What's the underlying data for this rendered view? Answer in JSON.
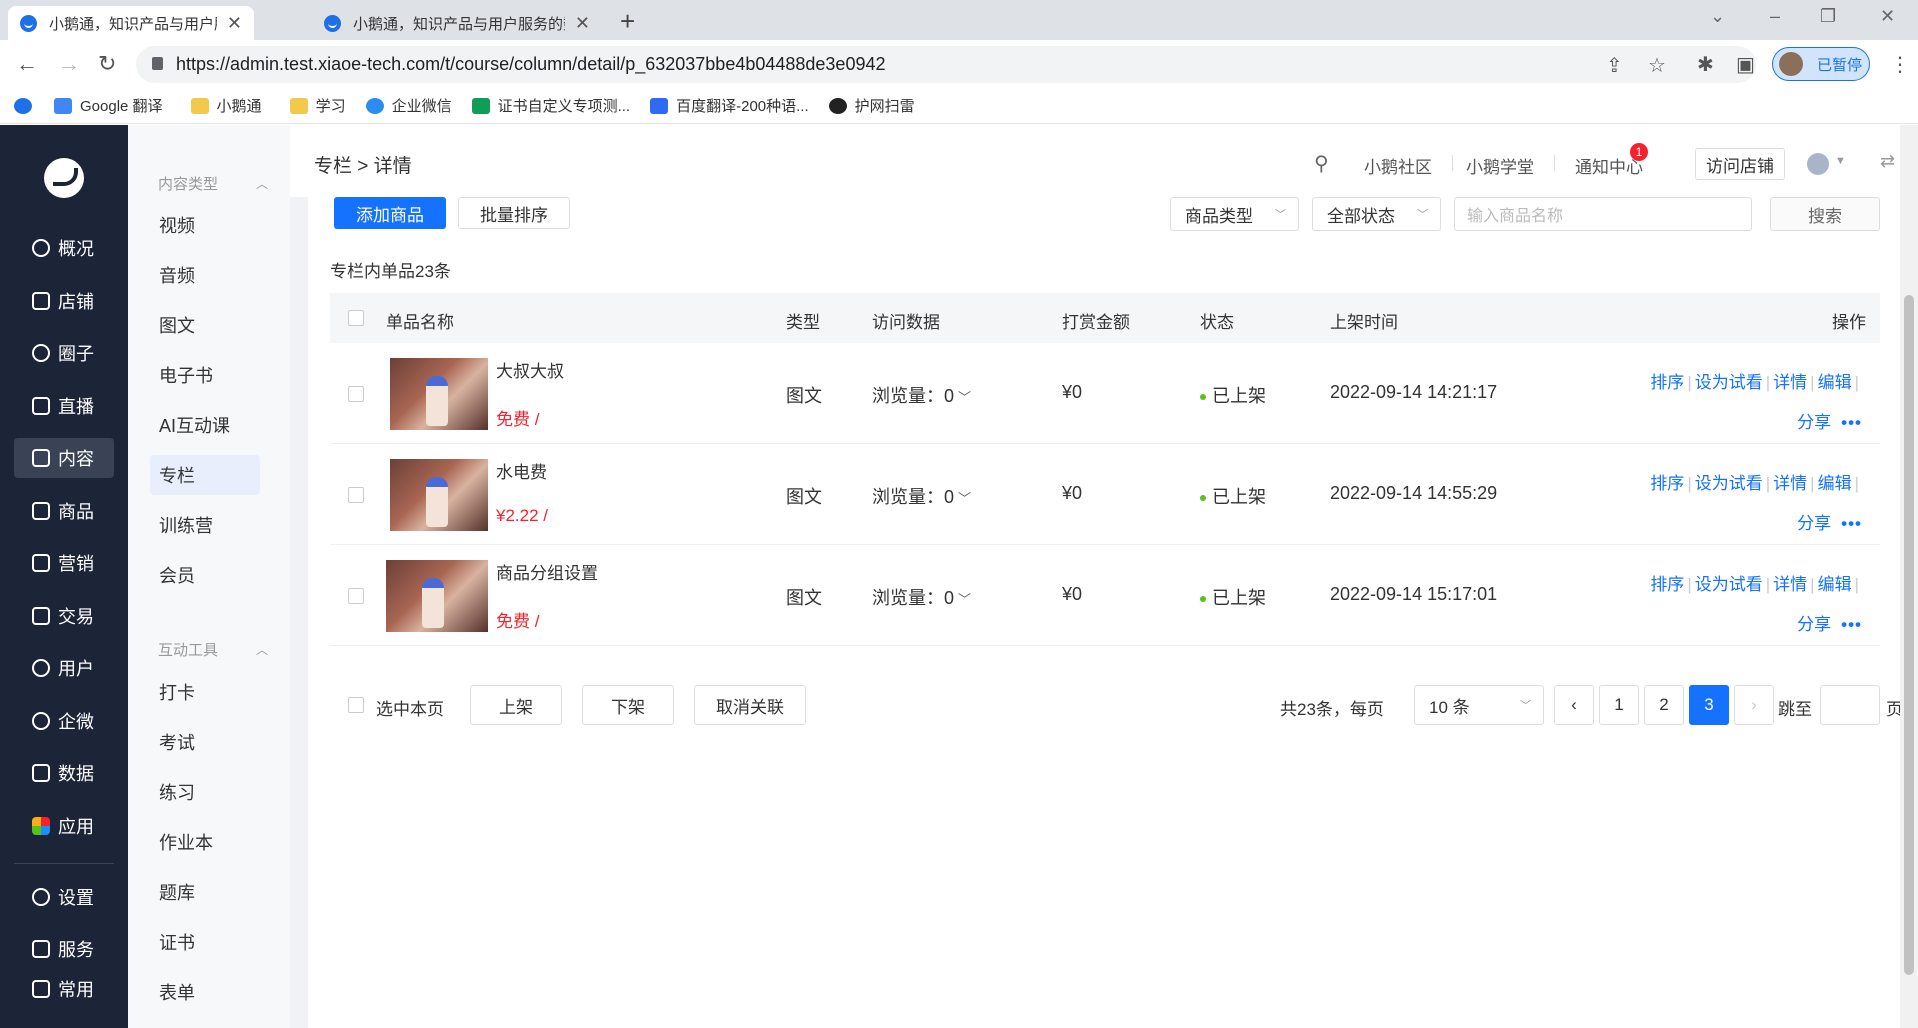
{
  "browser": {
    "tabs": [
      {
        "title": "小鹅通，知识产品与用户服务的数字化工具"
      },
      {
        "title": "小鹅通，知识产品与用户服务的数字化工具"
      }
    ],
    "url": "https://admin.test.xiaoe-tech.com/t/course/column/detail/p_632037bbe4b04488de3e0942",
    "profile_label": "已暂停",
    "bookmarks": [
      "Google 翻译",
      "小鹅通",
      "学习",
      "企业微信",
      "证书自定义专项测...",
      "百度翻译-200种语...",
      "护网扫雷"
    ]
  },
  "sidebar": {
    "items": [
      {
        "label": "概况",
        "icon": "pie-chart-icon"
      },
      {
        "label": "店铺",
        "icon": "store-icon"
      },
      {
        "label": "圈子",
        "icon": "community-icon"
      },
      {
        "label": "直播",
        "icon": "live-icon"
      },
      {
        "label": "内容",
        "icon": "content-icon"
      },
      {
        "label": "商品",
        "icon": "product-icon"
      },
      {
        "label": "营销",
        "icon": "megaphone-icon"
      },
      {
        "label": "交易",
        "icon": "trade-icon"
      },
      {
        "label": "用户",
        "icon": "user-icon"
      },
      {
        "label": "企微",
        "icon": "wecom-icon"
      },
      {
        "label": "数据",
        "icon": "data-icon"
      },
      {
        "label": "应用",
        "icon": "apps-icon"
      },
      {
        "label": "设置",
        "icon": "gear-icon"
      },
      {
        "label": "服务",
        "icon": "service-icon"
      },
      {
        "label": "常用",
        "icon": "list-icon"
      }
    ]
  },
  "subnav": {
    "group1": "内容类型",
    "group1_items": [
      "视频",
      "音频",
      "图文",
      "电子书",
      "AI互动课",
      "专栏",
      "训练营",
      "会员"
    ],
    "group2": "互动工具",
    "group2_items": [
      "打卡",
      "考试",
      "练习",
      "作业本",
      "题库",
      "证书",
      "表单"
    ]
  },
  "header": {
    "breadcrumb": "专栏 > 详情",
    "links": [
      "小鹅社区",
      "小鹅学堂",
      "通知中心"
    ],
    "notify_count": "1",
    "visit_store": "访问店铺"
  },
  "toolbar": {
    "add_product": "添加商品",
    "batch_sort": "批量排序",
    "product_type": "商品类型",
    "all_status": "全部状态",
    "search_placeholder": "输入商品名称",
    "search_btn": "搜索"
  },
  "list": {
    "count_label": "专栏内单品23条",
    "columns": [
      "单品名称",
      "类型",
      "访问数据",
      "打赏金额",
      "状态",
      "上架时间",
      "操作"
    ],
    "rows": [
      {
        "name": "大叔大叔",
        "price": "免费 /",
        "type": "图文",
        "views": "浏览量：0",
        "reward": "¥0",
        "status": "已上架",
        "time": "2022-09-14 14:21:17"
      },
      {
        "name": "水电费",
        "price": "¥2.22 /",
        "type": "图文",
        "views": "浏览量：0",
        "reward": "¥0",
        "status": "已上架",
        "time": "2022-09-14 14:55:29"
      },
      {
        "name": "商品分组设置",
        "price": "免费 /",
        "type": "图文",
        "views": "浏览量：0",
        "reward": "¥0",
        "status": "已上架",
        "time": "2022-09-14 15:17:01"
      }
    ],
    "ops": {
      "sort": "排序",
      "trial": "设为试看",
      "detail": "详情",
      "edit": "编辑",
      "share": "分享",
      "more": "•••"
    }
  },
  "footer": {
    "select_page": "选中本页",
    "on_shelf": "上架",
    "off_shelf": "下架",
    "unlink": "取消关联",
    "total": "共23条，每页",
    "per_page": "10 条",
    "pages": [
      "1",
      "2",
      "3"
    ],
    "current_page": "3",
    "jump_to": "跳至",
    "page_unit": "页"
  },
  "colors": {
    "primary": "#1472ff",
    "sidebar": "#1c2437",
    "price": "#f5222d",
    "status": "#52c41a"
  }
}
